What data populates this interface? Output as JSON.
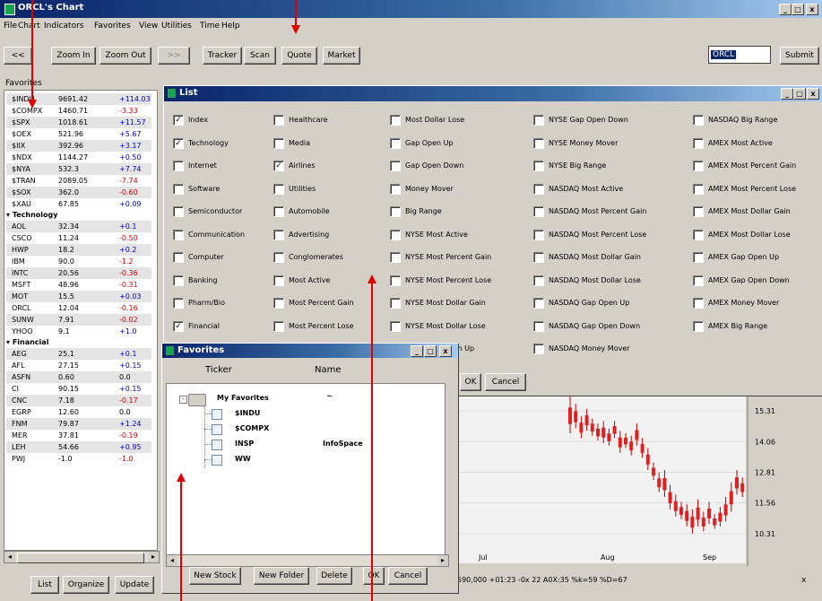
{
  "main_window": {
    "title": "ORCL's Chart",
    "menu": [
      "File",
      "Chart",
      "Indicators",
      "Favorites",
      "View",
      "Utilities",
      "Time",
      "Help"
    ],
    "toolbar": {
      "back": "<<",
      "zoom_in": "Zoom In",
      "zoom_out": "Zoom Out",
      "forward": ">>",
      "tracker": "Tracker",
      "scan": "Scan",
      "quote": "Quote",
      "market": "Market",
      "symbol_value": "ORCL",
      "submit": "Submit"
    },
    "controls": [
      "_",
      "□",
      "x"
    ]
  },
  "favorites_panel": {
    "title": "Favorites",
    "index_rows": [
      {
        "sym": "$INDU",
        "val": "9691.42",
        "chg": "+114.03",
        "sign": "pos"
      },
      {
        "sym": "$COMPX",
        "val": "1460.71",
        "chg": "-3.33",
        "sign": "neg"
      },
      {
        "sym": "$SPX",
        "val": "1018.61",
        "chg": "+11.57",
        "sign": "pos"
      },
      {
        "sym": "$OEX",
        "val": "521.96",
        "chg": "+5.67",
        "sign": "pos"
      },
      {
        "sym": "$IIX",
        "val": "392.96",
        "chg": "+3.17",
        "sign": "pos"
      },
      {
        "sym": "$NDX",
        "val": "1144.27",
        "chg": "+0.50",
        "sign": "pos"
      },
      {
        "sym": "$NYA",
        "val": "532.3",
        "chg": "+7.74",
        "sign": "pos"
      },
      {
        "sym": "$TRAN",
        "val": "2089.05",
        "chg": "-7.74",
        "sign": "neg"
      },
      {
        "sym": "$SOX",
        "val": "362.0",
        "chg": "-0.60",
        "sign": "neg"
      },
      {
        "sym": "$XAU",
        "val": "67.85",
        "chg": "+0.09",
        "sign": "pos"
      }
    ],
    "tech_group": "Technology",
    "tech_rows": [
      {
        "sym": "AOL",
        "val": "32.34",
        "chg": "+0.1",
        "sign": "pos"
      },
      {
        "sym": "CSCO",
        "val": "11.24",
        "chg": "-0.50",
        "sign": "neg"
      },
      {
        "sym": "HWP",
        "val": "18.2",
        "chg": "+0.2",
        "sign": "pos"
      },
      {
        "sym": "IBM",
        "val": "90.0",
        "chg": "-1.2",
        "sign": "neg"
      },
      {
        "sym": "INTC",
        "val": "20.56",
        "chg": "-0.36",
        "sign": "neg"
      },
      {
        "sym": "MSFT",
        "val": "48.96",
        "chg": "-0.31",
        "sign": "neg"
      },
      {
        "sym": "MOT",
        "val": "15.5",
        "chg": "+0.03",
        "sign": "pos"
      },
      {
        "sym": "ORCL",
        "val": "12.04",
        "chg": "-0.16",
        "sign": "neg"
      },
      {
        "sym": "SUNW",
        "val": "7.91",
        "chg": "-0.02",
        "sign": "neg"
      },
      {
        "sym": "YHOO",
        "val": "9.1",
        "chg": "+1.0",
        "sign": "pos"
      }
    ],
    "fin_group": "Financial",
    "fin_rows": [
      {
        "sym": "AEG",
        "val": "25.1",
        "chg": "+0.1",
        "sign": "pos"
      },
      {
        "sym": "AFL",
        "val": "27.15",
        "chg": "+0.15",
        "sign": "pos"
      },
      {
        "sym": "ASFN",
        "val": "0.60",
        "chg": "0.0",
        "sign": "neu"
      },
      {
        "sym": "CI",
        "val": "90.15",
        "chg": "+0.15",
        "sign": "pos"
      },
      {
        "sym": "CNC",
        "val": "7.18",
        "chg": "-0.17",
        "sign": "neg"
      },
      {
        "sym": "EGRP",
        "val": "12.60",
        "chg": "0.0",
        "sign": "neu"
      },
      {
        "sym": "FNM",
        "val": "79.87",
        "chg": "+1.24",
        "sign": "pos"
      },
      {
        "sym": "MER",
        "val": "37.81",
        "chg": "-0.19",
        "sign": "neg"
      },
      {
        "sym": "LEH",
        "val": "54.66",
        "chg": "+0.95",
        "sign": "pos"
      },
      {
        "sym": "PWJ",
        "val": "-1.0",
        "chg": "-1.0",
        "sign": "neg"
      }
    ],
    "buttons": {
      "list": "List",
      "organize": "Organize",
      "update": "Update"
    }
  },
  "list_dialog": {
    "title": "List",
    "columns": [
      [
        {
          "label": "Index",
          "checked": true
        },
        {
          "label": "Technology",
          "checked": true
        },
        {
          "label": "Internet",
          "checked": false
        },
        {
          "label": "Software",
          "checked": false
        },
        {
          "label": "Semiconductor",
          "checked": false
        },
        {
          "label": "Communication",
          "checked": false
        },
        {
          "label": "Computer",
          "checked": false
        },
        {
          "label": "Banking",
          "checked": false
        },
        {
          "label": "Pharm/Bio",
          "checked": false
        },
        {
          "label": "Financial",
          "checked": true
        }
      ],
      [
        {
          "label": "Healthcare",
          "checked": false
        },
        {
          "label": "Media",
          "checked": false
        },
        {
          "label": "Airlines",
          "checked": true
        },
        {
          "label": "Utilities",
          "checked": false
        },
        {
          "label": "Automobile",
          "checked": false
        },
        {
          "label": "Advertising",
          "checked": false
        },
        {
          "label": "Conglomerates",
          "checked": false
        },
        {
          "label": "Most Active",
          "checked": false
        },
        {
          "label": "Most Percent Gain",
          "checked": false
        },
        {
          "label": "Most Percent Lose",
          "checked": false
        }
      ],
      [
        {
          "label": "Most Dollar Lose",
          "checked": false
        },
        {
          "label": "Gap Open Up",
          "checked": false
        },
        {
          "label": "Gap Open Down",
          "checked": false
        },
        {
          "label": "Money Mover",
          "checked": false
        },
        {
          "label": "Big Range",
          "checked": false
        },
        {
          "label": "NYSE Most Active",
          "checked": false
        },
        {
          "label": "NYSE Most Percent Gain",
          "checked": false
        },
        {
          "label": "NYSE Most Percent Lose",
          "checked": false
        },
        {
          "label": "NYSE Most Dollar Gain",
          "checked": false
        },
        {
          "label": "NYSE Most Dollar Lose",
          "checked": false
        },
        {
          "label": "NYSE Gap Open Up",
          "checked": false
        }
      ],
      [
        {
          "label": "NYSE Gap Open Down",
          "checked": false
        },
        {
          "label": "NYSE Money Mover",
          "checked": false
        },
        {
          "label": "NYSE Big Range",
          "checked": false
        },
        {
          "label": "NASDAQ Most Active",
          "checked": false
        },
        {
          "label": "NASDAQ Most Percent Gain",
          "checked": false
        },
        {
          "label": "NASDAQ Most Percent Lose",
          "checked": false
        },
        {
          "label": "NASDAQ Most Dollar Gain",
          "checked": false
        },
        {
          "label": "NASDAQ Most Dollar Lose",
          "checked": false
        },
        {
          "label": "NASDAQ Gap Open Up",
          "checked": false
        },
        {
          "label": "NASDAQ Gap Open Down",
          "checked": false
        },
        {
          "label": "NASDAQ Money Mover",
          "checked": false
        }
      ],
      [
        {
          "label": "NASDAQ Big Range",
          "checked": false
        },
        {
          "label": "AMEX Most Active",
          "checked": false
        },
        {
          "label": "AMEX Most Percent Gain",
          "checked": false
        },
        {
          "label": "AMEX Most Percent Lose",
          "checked": false
        },
        {
          "label": "AMEX Most Dollar Gain",
          "checked": false
        },
        {
          "label": "AMEX Most Dollar Lose",
          "checked": false
        },
        {
          "label": "AMEX Gap Open Up",
          "checked": false
        },
        {
          "label": "AMEX Gap Open Down",
          "checked": false
        },
        {
          "label": "AMEX Money Mover",
          "checked": false
        },
        {
          "label": "AMEX Big Range",
          "checked": false
        }
      ]
    ],
    "ok": "OK",
    "cancel": "Cancel"
  },
  "favorites_dialog": {
    "title": "Favorites",
    "col_ticker": "Ticker",
    "col_name": "Name",
    "root": "My Favorites",
    "root_name": "~",
    "items": [
      {
        "ticker": "$INDU",
        "name": ""
      },
      {
        "ticker": "$COMPX",
        "name": ""
      },
      {
        "ticker": "INSP",
        "name": "InfoSpace"
      },
      {
        "ticker": "WW",
        "name": ""
      }
    ],
    "buttons": {
      "new_stock": "New Stock",
      "new_folder": "New Folder",
      "delete": "Delete",
      "ok": "OK",
      "cancel": "Cancel"
    }
  },
  "chart": {
    "y_ticks": [
      "15.31",
      "14.06",
      "12.81",
      "11.56",
      "10.31"
    ],
    "x_ticks": [
      "Jul",
      "Aug",
      "Sep"
    ],
    "status": "590,000 +01:23 -0x 22 A0X:35 %k=59 %D=67",
    "candles": [
      [
        14.4,
        15.9
      ],
      [
        14.6,
        15.6
      ],
      [
        14.2,
        15.1
      ],
      [
        14.5,
        15.4
      ],
      [
        14.3,
        15.0
      ],
      [
        14.1,
        14.8
      ],
      [
        14.0,
        14.9
      ],
      [
        13.9,
        14.6
      ],
      [
        14.2,
        14.9
      ],
      [
        13.6,
        14.5
      ],
      [
        13.8,
        14.4
      ],
      [
        13.5,
        14.3
      ],
      [
        13.9,
        14.8
      ],
      [
        13.4,
        14.2
      ],
      [
        12.9,
        13.8
      ],
      [
        12.5,
        13.2
      ],
      [
        12.0,
        12.8
      ],
      [
        11.8,
        12.9
      ],
      [
        11.3,
        12.3
      ],
      [
        11.0,
        11.9
      ],
      [
        10.9,
        11.6
      ],
      [
        10.6,
        11.5
      ],
      [
        10.3,
        11.3
      ],
      [
        10.6,
        11.7
      ],
      [
        10.4,
        11.2
      ],
      [
        10.7,
        11.6
      ],
      [
        10.5,
        11.1
      ],
      [
        10.6,
        11.4
      ],
      [
        10.8,
        11.8
      ],
      [
        11.2,
        12.4
      ],
      [
        11.9,
        12.9
      ],
      [
        11.8,
        12.6
      ]
    ]
  }
}
